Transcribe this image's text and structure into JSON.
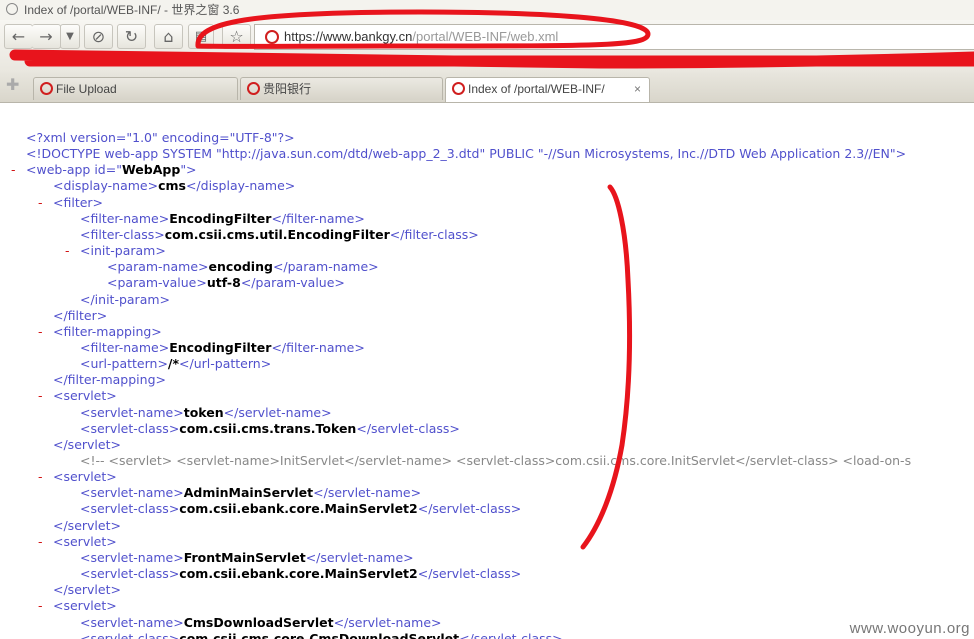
{
  "window": {
    "title": "Index of /portal/WEB-INF/ - 世界之窗 3.6"
  },
  "toolbar": {
    "url_host": "https://www.bankgy.cn",
    "url_path": "/portal/WEB-INF/web.xml"
  },
  "tabs": [
    {
      "label": "File Upload",
      "active": false
    },
    {
      "label": "贵阳银行",
      "active": false
    },
    {
      "label": "Index of /portal/WEB-INF/",
      "active": true,
      "close": "×"
    }
  ],
  "xml_lines": [
    {
      "toggle": "",
      "indent": 0,
      "parts": [
        [
          "tag",
          "<?xml version=\"1.0\" encoding=\"UTF-8\"?>"
        ]
      ]
    },
    {
      "toggle": "",
      "indent": 0,
      "parts": [
        [
          "tag",
          "<!DOCTYPE web-app SYSTEM \"http://java.sun.com/dtd/web-app_2_3.dtd\" PUBLIC \"-//Sun Microsystems, Inc.//DTD Web Application 2.3//EN\">"
        ]
      ]
    },
    {
      "toggle": "-",
      "indent": 0,
      "parts": [
        [
          "tag",
          "<web-app id=\""
        ],
        [
          "val",
          "WebApp"
        ],
        [
          "tag",
          "\">"
        ]
      ]
    },
    {
      "toggle": "",
      "indent": 1,
      "parts": [
        [
          "tag",
          "<display-name>"
        ],
        [
          "val",
          "cms"
        ],
        [
          "tag",
          "</display-name>"
        ]
      ]
    },
    {
      "toggle": "-",
      "indent": 1,
      "parts": [
        [
          "tag",
          "<filter>"
        ]
      ]
    },
    {
      "toggle": "",
      "indent": 2,
      "parts": [
        [
          "tag",
          "<filter-name>"
        ],
        [
          "val",
          "EncodingFilter"
        ],
        [
          "tag",
          "</filter-name>"
        ]
      ]
    },
    {
      "toggle": "",
      "indent": 2,
      "parts": [
        [
          "tag",
          "<filter-class>"
        ],
        [
          "val",
          "com.csii.cms.util.EncodingFilter"
        ],
        [
          "tag",
          "</filter-class>"
        ]
      ]
    },
    {
      "toggle": "-",
      "indent": 2,
      "parts": [
        [
          "tag",
          "<init-param>"
        ]
      ]
    },
    {
      "toggle": "",
      "indent": 3,
      "parts": [
        [
          "tag",
          "<param-name>"
        ],
        [
          "val",
          "encoding"
        ],
        [
          "tag",
          "</param-name>"
        ]
      ]
    },
    {
      "toggle": "",
      "indent": 3,
      "parts": [
        [
          "tag",
          "<param-value>"
        ],
        [
          "val",
          "utf-8"
        ],
        [
          "tag",
          "</param-value>"
        ]
      ]
    },
    {
      "toggle": "",
      "indent": 2,
      "parts": [
        [
          "tag",
          "</init-param>"
        ]
      ]
    },
    {
      "toggle": "",
      "indent": 1,
      "parts": [
        [
          "tag",
          "</filter>"
        ]
      ]
    },
    {
      "toggle": "-",
      "indent": 1,
      "parts": [
        [
          "tag",
          "<filter-mapping>"
        ]
      ]
    },
    {
      "toggle": "",
      "indent": 2,
      "parts": [
        [
          "tag",
          "<filter-name>"
        ],
        [
          "val",
          "EncodingFilter"
        ],
        [
          "tag",
          "</filter-name>"
        ]
      ]
    },
    {
      "toggle": "",
      "indent": 2,
      "parts": [
        [
          "tag",
          "<url-pattern>"
        ],
        [
          "val",
          "/*"
        ],
        [
          "tag",
          "</url-pattern>"
        ]
      ]
    },
    {
      "toggle": "",
      "indent": 1,
      "parts": [
        [
          "tag",
          "</filter-mapping>"
        ]
      ]
    },
    {
      "toggle": "-",
      "indent": 1,
      "parts": [
        [
          "tag",
          "<servlet>"
        ]
      ]
    },
    {
      "toggle": "",
      "indent": 2,
      "parts": [
        [
          "tag",
          "<servlet-name>"
        ],
        [
          "val",
          "token"
        ],
        [
          "tag",
          "</servlet-name>"
        ]
      ]
    },
    {
      "toggle": "",
      "indent": 2,
      "parts": [
        [
          "tag",
          "<servlet-class>"
        ],
        [
          "val",
          "com.csii.cms.trans.Token"
        ],
        [
          "tag",
          "</servlet-class>"
        ]
      ]
    },
    {
      "toggle": "",
      "indent": 1,
      "parts": [
        [
          "tag",
          "</servlet>"
        ]
      ]
    },
    {
      "toggle": "",
      "indent": 2,
      "parts": [
        [
          "comment",
          "<!-- <servlet> <servlet-name>InitServlet</servlet-name> <servlet-class>com.csii.cms.core.InitServlet</servlet-class> <load-on-s"
        ]
      ]
    },
    {
      "toggle": "-",
      "indent": 1,
      "parts": [
        [
          "tag",
          "<servlet>"
        ]
      ]
    },
    {
      "toggle": "",
      "indent": 2,
      "parts": [
        [
          "tag",
          "<servlet-name>"
        ],
        [
          "val",
          "AdminMainServlet"
        ],
        [
          "tag",
          "</servlet-name>"
        ]
      ]
    },
    {
      "toggle": "",
      "indent": 2,
      "parts": [
        [
          "tag",
          "<servlet-class>"
        ],
        [
          "val",
          "com.csii.ebank.core.MainServlet2"
        ],
        [
          "tag",
          "</servlet-class>"
        ]
      ]
    },
    {
      "toggle": "",
      "indent": 1,
      "parts": [
        [
          "tag",
          "</servlet>"
        ]
      ]
    },
    {
      "toggle": "-",
      "indent": 1,
      "parts": [
        [
          "tag",
          "<servlet>"
        ]
      ]
    },
    {
      "toggle": "",
      "indent": 2,
      "parts": [
        [
          "tag",
          "<servlet-name>"
        ],
        [
          "val",
          "FrontMainServlet"
        ],
        [
          "tag",
          "</servlet-name>"
        ]
      ]
    },
    {
      "toggle": "",
      "indent": 2,
      "parts": [
        [
          "tag",
          "<servlet-class>"
        ],
        [
          "val",
          "com.csii.ebank.core.MainServlet2"
        ],
        [
          "tag",
          "</servlet-class>"
        ]
      ]
    },
    {
      "toggle": "",
      "indent": 1,
      "parts": [
        [
          "tag",
          "</servlet>"
        ]
      ]
    },
    {
      "toggle": "-",
      "indent": 1,
      "parts": [
        [
          "tag",
          "<servlet>"
        ]
      ]
    },
    {
      "toggle": "",
      "indent": 2,
      "parts": [
        [
          "tag",
          "<servlet-name>"
        ],
        [
          "val",
          "CmsDownloadServlet"
        ],
        [
          "tag",
          "</servlet-name>"
        ]
      ]
    },
    {
      "toggle": "",
      "indent": 2,
      "parts": [
        [
          "tag",
          "<servlet-class>"
        ],
        [
          "val",
          "com.csii.cms.core.CmsDownloadServlet"
        ],
        [
          "tag",
          "</servlet-class>"
        ]
      ]
    }
  ],
  "watermark": "www.wooyun.org",
  "colors": {
    "annotation": "#e8141c",
    "tag": "#5050cc",
    "toggle": "#d21414"
  }
}
